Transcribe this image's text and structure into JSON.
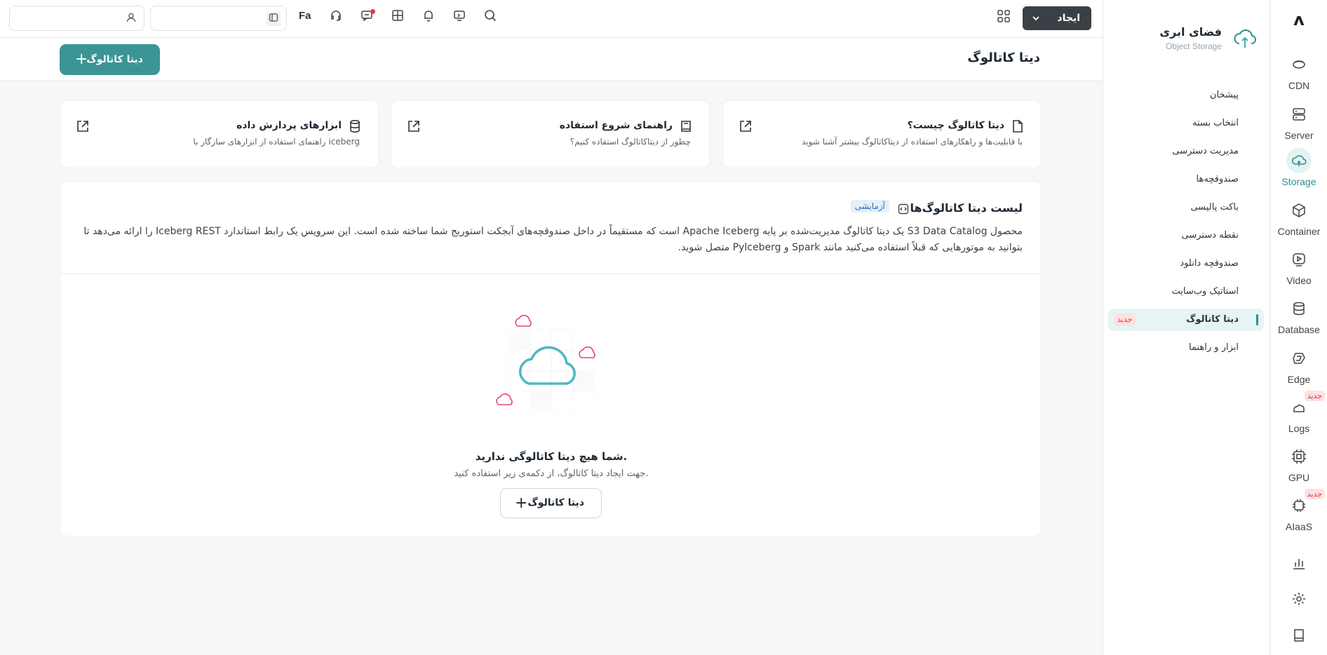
{
  "brand": {
    "title": "فضای ابری",
    "subtitle": "Object Storage",
    "logo_icon": "upload-cloud-icon"
  },
  "rail": {
    "logo": "ʌ",
    "items": [
      {
        "label": "CDN",
        "icon": "globe-icon"
      },
      {
        "label": "Server",
        "icon": "server-icon"
      },
      {
        "label": "Storage",
        "icon": "cloud-icon",
        "active": true
      },
      {
        "label": "Container",
        "icon": "cube-icon"
      },
      {
        "label": "Video",
        "icon": "play-icon"
      },
      {
        "label": "Database",
        "icon": "database-icon"
      },
      {
        "label": "Edge",
        "icon": "edge-icon"
      },
      {
        "label": "Logs",
        "icon": "logs-icon",
        "badge": "جدید"
      },
      {
        "label": "GPU",
        "icon": "chip-icon"
      },
      {
        "label": "AIaaS",
        "icon": "ai-chip-icon",
        "badge": "جدید"
      }
    ],
    "bottom_icons": [
      "chart-icon",
      "gear-icon",
      "book-icon"
    ]
  },
  "sidebar": {
    "items": [
      {
        "label": "پیشخان"
      },
      {
        "label": "انتخاب بسته"
      },
      {
        "label": "مدیریت دسترسی"
      },
      {
        "label": "صندوقچه‌ها"
      },
      {
        "label": "باکت پالیسی"
      },
      {
        "label": "نقطه دسترسی"
      },
      {
        "label": "صندوقچه دانلود"
      },
      {
        "label": "استاتیک وب‌سایت"
      },
      {
        "label": "دیتا کاتالوگ",
        "active": true,
        "badge": "جدید"
      },
      {
        "label": "ابزار و راهنما"
      }
    ]
  },
  "topbar": {
    "create_label": "ایجاد",
    "language": "Fa",
    "search_placeholder": "",
    "user_placeholder": ""
  },
  "page": {
    "title": "دیتا کاتالوگ",
    "new_button": "دیتا کاتالوگ"
  },
  "cards": [
    {
      "title": "دیتا کاتالوگ چیست؟",
      "desc": "با قابلیت‌ها و راهکارهای استفاده از دیتاکاتالوگ بیشتر آشنا شوید",
      "icon": "file-icon"
    },
    {
      "title": "راهنمای شروع استفاده",
      "desc": "چطور از دیتاکاتالوگ استفاده کنیم؟",
      "icon": "book-icon"
    },
    {
      "title": "ابزارهای پردازش داده",
      "desc": "راهنمای استفاده از ابزارهای سازگار با iceberg",
      "icon": "database-icon"
    }
  ],
  "panel": {
    "title": "لیست دیتا کاتالوگ‌ها",
    "tag": "آزمایشی",
    "desc": "محصول S3 Data Catalog یک دیتا کاتالوگ مدیریت‌شده بر پایه Apache Iceberg است که مستقیماً در داخل صندوقچه‌های آبجکت استوریج شما ساخته شده است. این سرویس یک رابط استاندارد Iceberg REST را ارائه می‌دهد تا بتوانید به موتورهایی که قبلاً استفاده می‌کنید مانند Spark و Pylceberg متصل شوید.",
    "empty_title": "شما هیچ دیتا کاتالوگی ندارید.",
    "empty_desc": "جهت ایجاد دیتا کاتالوگ، از دکمه‌ی زیر استفاده کنید.",
    "empty_button": "دیتا کاتالوگ"
  },
  "colors": {
    "primary": "#3b9595",
    "dark": "#3b4046",
    "badge_bg": "#fde2e2",
    "badge_fg": "#d63b3b",
    "cloud": "#4fb8bd",
    "small_cloud": "#e0486a"
  }
}
